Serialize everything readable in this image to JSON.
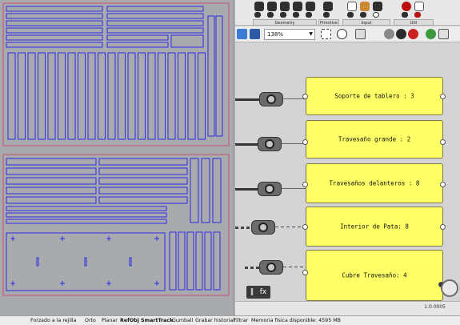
{
  "grasshopper": {
    "ribbon_groups": [
      "Geometry",
      "Primitive",
      "Input",
      "Util"
    ],
    "zoom_level": "138%",
    "panels": [
      "Soporte de tablero : 3",
      "Travesaño grande : 2",
      "Travesaños delanteros : 8",
      "Interior de Pata: 8",
      "Cubre Travesaño: 4"
    ],
    "version": "1.0.0005",
    "grid_icon": "‖",
    "fx_icon": "fx"
  },
  "statusbar": {
    "items": [
      {
        "label": "Forzado a la rejilla",
        "active": false
      },
      {
        "label": "Orto",
        "active": false
      },
      {
        "label": "Planar",
        "active": false
      },
      {
        "label": "RefObj",
        "active": true
      },
      {
        "label": "SmartTrack",
        "active": true
      },
      {
        "label": "Gumball",
        "active": false
      },
      {
        "label": "Grabar historial",
        "active": false
      },
      {
        "label": "Filtrar",
        "active": false
      }
    ],
    "memory": "Memoria física disponible: 4595 MB"
  },
  "colors": {
    "viewport_bg": "#a8aaad",
    "sheet_border": "#c0607a",
    "part_outline": "#2e2ee6",
    "panel_yellow": "#ffff66"
  }
}
